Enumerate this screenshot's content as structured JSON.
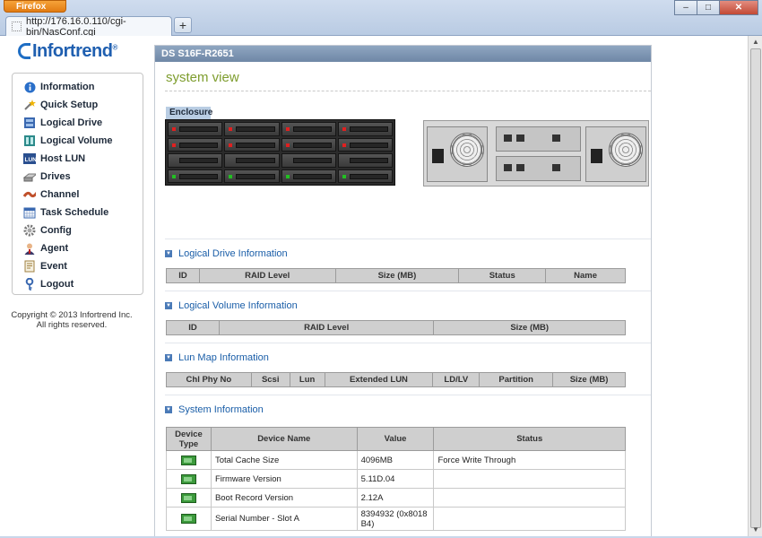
{
  "browser": {
    "menu_button": "Firefox",
    "tab_url": "http://176.16.0.110/cgi-bin/NasConf.cgi",
    "new_tab": "+",
    "window_controls": [
      "–",
      "□",
      "✕"
    ]
  },
  "logo": {
    "text": "Infortrend",
    "mark": "®"
  },
  "sidebar": {
    "items": [
      {
        "label": "Information",
        "icon": "info-icon"
      },
      {
        "label": "Quick Setup",
        "icon": "wand-icon"
      },
      {
        "label": "Logical Drive",
        "icon": "logical-drive-icon"
      },
      {
        "label": "Logical Volume",
        "icon": "logical-volume-icon"
      },
      {
        "label": "Host LUN",
        "icon": "lun-icon"
      },
      {
        "label": "Drives",
        "icon": "drive-icon"
      },
      {
        "label": "Channel",
        "icon": "channel-icon"
      },
      {
        "label": "Task Schedule",
        "icon": "calendar-icon"
      },
      {
        "label": "Config",
        "icon": "gear-icon"
      },
      {
        "label": "Agent",
        "icon": "agent-icon"
      },
      {
        "label": "Event",
        "icon": "event-icon"
      },
      {
        "label": "Logout",
        "icon": "key-icon"
      }
    ]
  },
  "copyright": {
    "line1": "Copyright © 2013 Infortrend Inc.",
    "line2": "All rights reserved."
  },
  "main": {
    "header": "DS S16F-R2651",
    "title": "system view",
    "enclosure_tab": "Enclosure",
    "drive_leds": [
      "red",
      "red",
      "red",
      "red",
      "red",
      "red",
      "red",
      "red",
      "none",
      "none",
      "none",
      "none",
      "green",
      "green",
      "green",
      "green"
    ]
  },
  "sections": {
    "logical_drive": {
      "title": "Logical Drive Information",
      "columns": [
        "ID",
        "RAID Level",
        "Size (MB)",
        "Status",
        "Name"
      ]
    },
    "logical_volume": {
      "title": "Logical Volume Information",
      "columns": [
        "ID",
        "RAID Level",
        "Size (MB)"
      ]
    },
    "lun_map": {
      "title": "Lun Map Information",
      "columns": [
        "Chl Phy No",
        "Scsi",
        "Lun",
        "Extended LUN",
        "LD/LV",
        "Partition",
        "Size (MB)"
      ]
    },
    "system": {
      "title": "System Information",
      "columns": [
        "Device Type",
        "Device Name",
        "Value",
        "Status"
      ],
      "rows": [
        {
          "name": "Total Cache Size",
          "value": "4096MB",
          "status": "Force Write Through"
        },
        {
          "name": "Firmware Version",
          "value": "5.11D.04",
          "status": ""
        },
        {
          "name": "Boot Record Version",
          "value": "2.12A",
          "status": ""
        },
        {
          "name": "Serial Number - Slot A",
          "value": "8394932 (0x8018B4)",
          "status": ""
        }
      ]
    }
  },
  "colors": {
    "accent": "#7e9d2e",
    "header": "#7a91af",
    "link": "#1a5ea8",
    "led_red": "#e02020",
    "led_green": "#22c022"
  }
}
